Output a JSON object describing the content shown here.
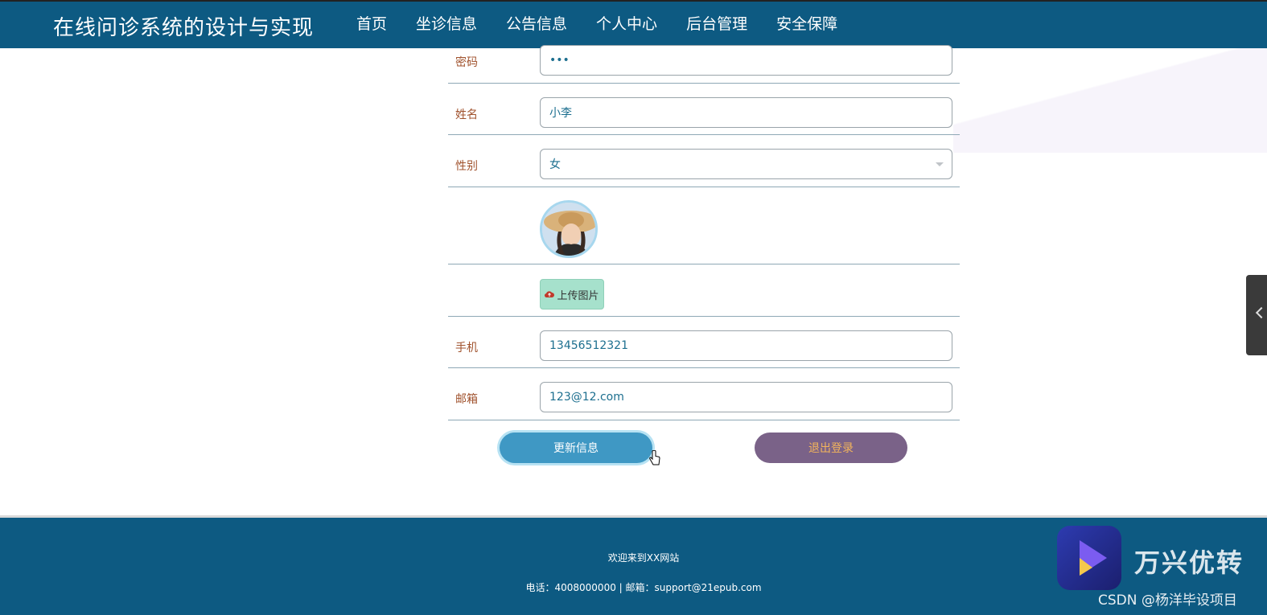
{
  "header": {
    "site_title": "在线问诊系统的设计与实现",
    "nav": [
      {
        "label": "首页",
        "active": false
      },
      {
        "label": "坐诊信息",
        "active": false
      },
      {
        "label": "公告信息",
        "active": false
      },
      {
        "label": "个人中心",
        "active": true
      },
      {
        "label": "后台管理",
        "active": false
      },
      {
        "label": "安全保障",
        "active": false
      }
    ]
  },
  "form": {
    "password": {
      "label": "密码",
      "value": "•••"
    },
    "name": {
      "label": "姓名",
      "value": "小李"
    },
    "gender": {
      "label": "性别",
      "value": "女"
    },
    "upload_label": "上传图片",
    "phone": {
      "label": "手机",
      "value": "13456512321"
    },
    "email": {
      "label": "邮箱",
      "value": "123@12.com"
    },
    "update_button": "更新信息",
    "logout_button": "退出登录"
  },
  "footer": {
    "welcome": "欢迎来到XX网站",
    "contact": "电话：4008000000 | 邮箱：support@21epub.com"
  },
  "watermark": {
    "brand": "万兴优转",
    "csdn": "CSDN @杨洋毕设项目"
  },
  "colors": {
    "header_bg": "#0d5a82",
    "label": "#a0522d",
    "update_button": "#3f98c4",
    "logout_button": "#7a6288",
    "upload_button": "#a6e1cc"
  }
}
